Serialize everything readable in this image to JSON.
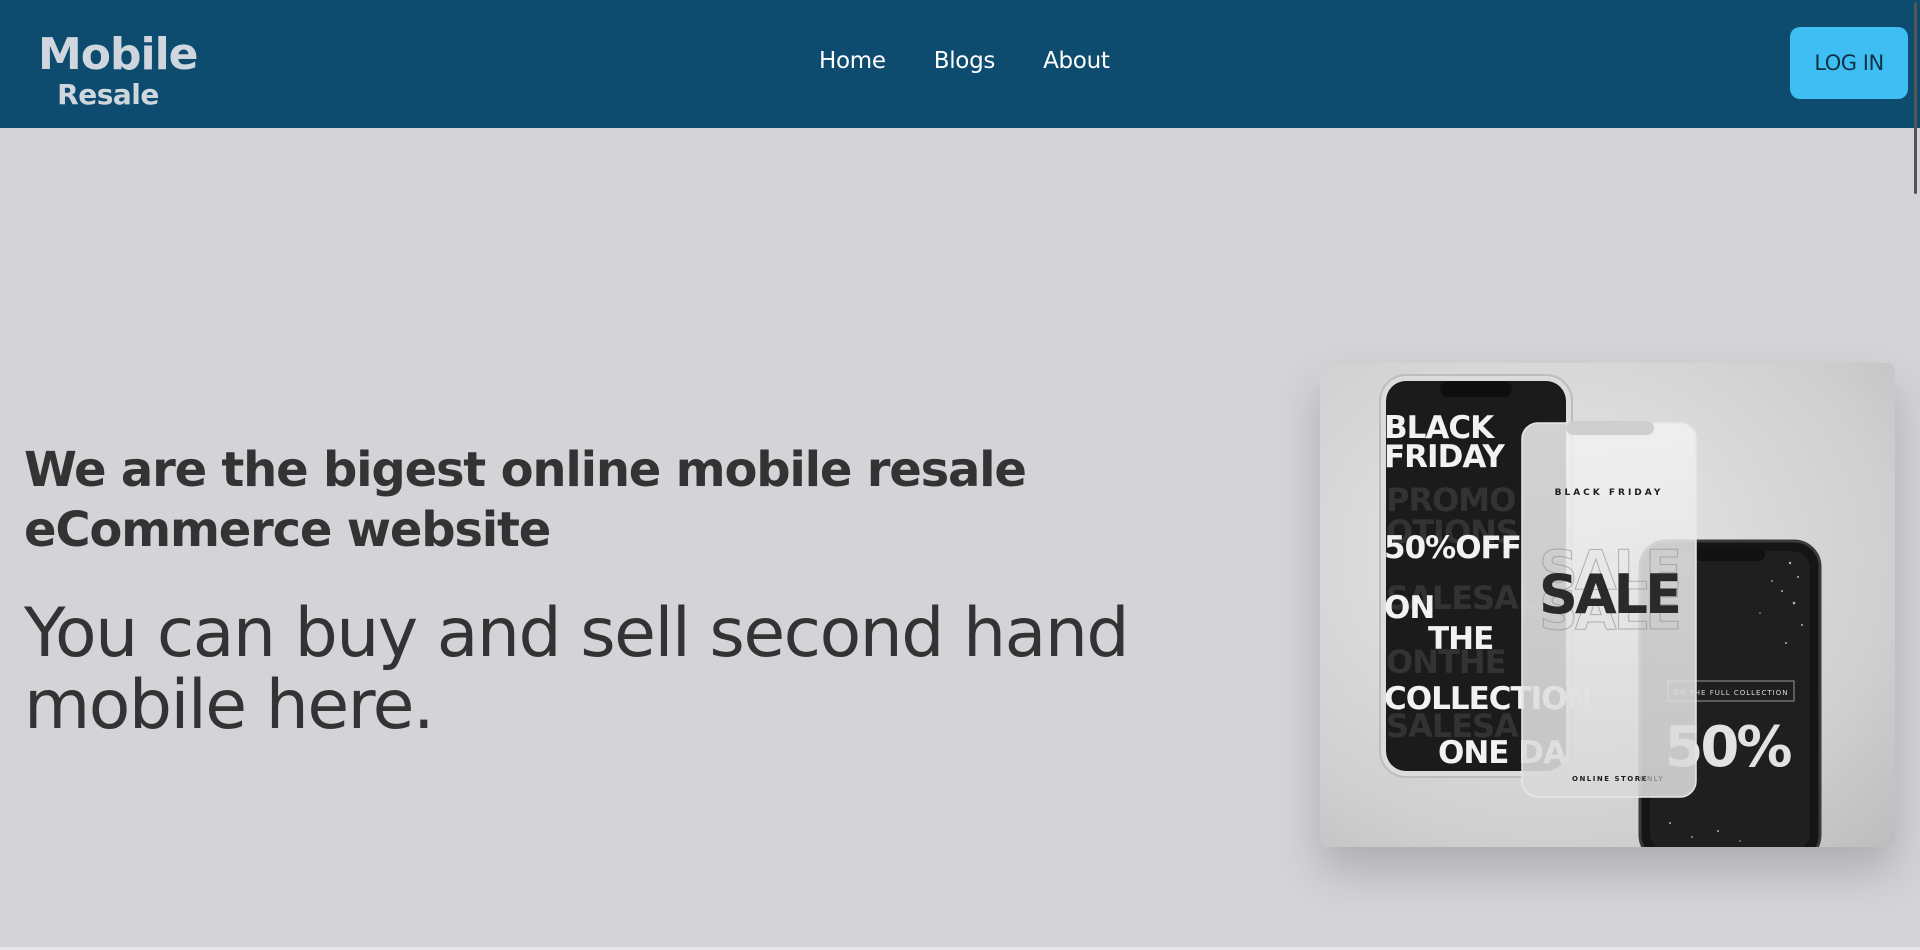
{
  "brand": {
    "line1": "Mobile",
    "line2": "Resale"
  },
  "nav": {
    "items": [
      {
        "label": "Home"
      },
      {
        "label": "Blogs"
      },
      {
        "label": "About"
      }
    ],
    "login_label": "LOG IN"
  },
  "hero": {
    "headline": "We are the bigest online mobile resale eCommerce website",
    "subtext": "You can buy and sell second hand mobile here.",
    "image": {
      "phone_left": {
        "lines": [
          "BLACK",
          "FRIDAY",
          "50%OFF",
          "ON",
          "THE",
          "COLLECTION",
          "ONE DA"
        ],
        "background_words": [
          "PROMO",
          "OTIONS",
          "SALESAL",
          "ONTHE",
          "SALESA"
        ]
      },
      "phone_middle": {
        "top_text": "BLACK FRIDAY",
        "big_text": "SALE",
        "bottom_text": "ONLINE STORE",
        "bottom_text_light": "ONLY"
      },
      "phone_right": {
        "caption": "ON THE FULL COLLECTION",
        "percent": "50%"
      }
    }
  },
  "colors": {
    "navbar": "#0d4c6f",
    "page_bg": "#d4d3d8",
    "login_button": "#3ebef3",
    "text": "#333333"
  }
}
